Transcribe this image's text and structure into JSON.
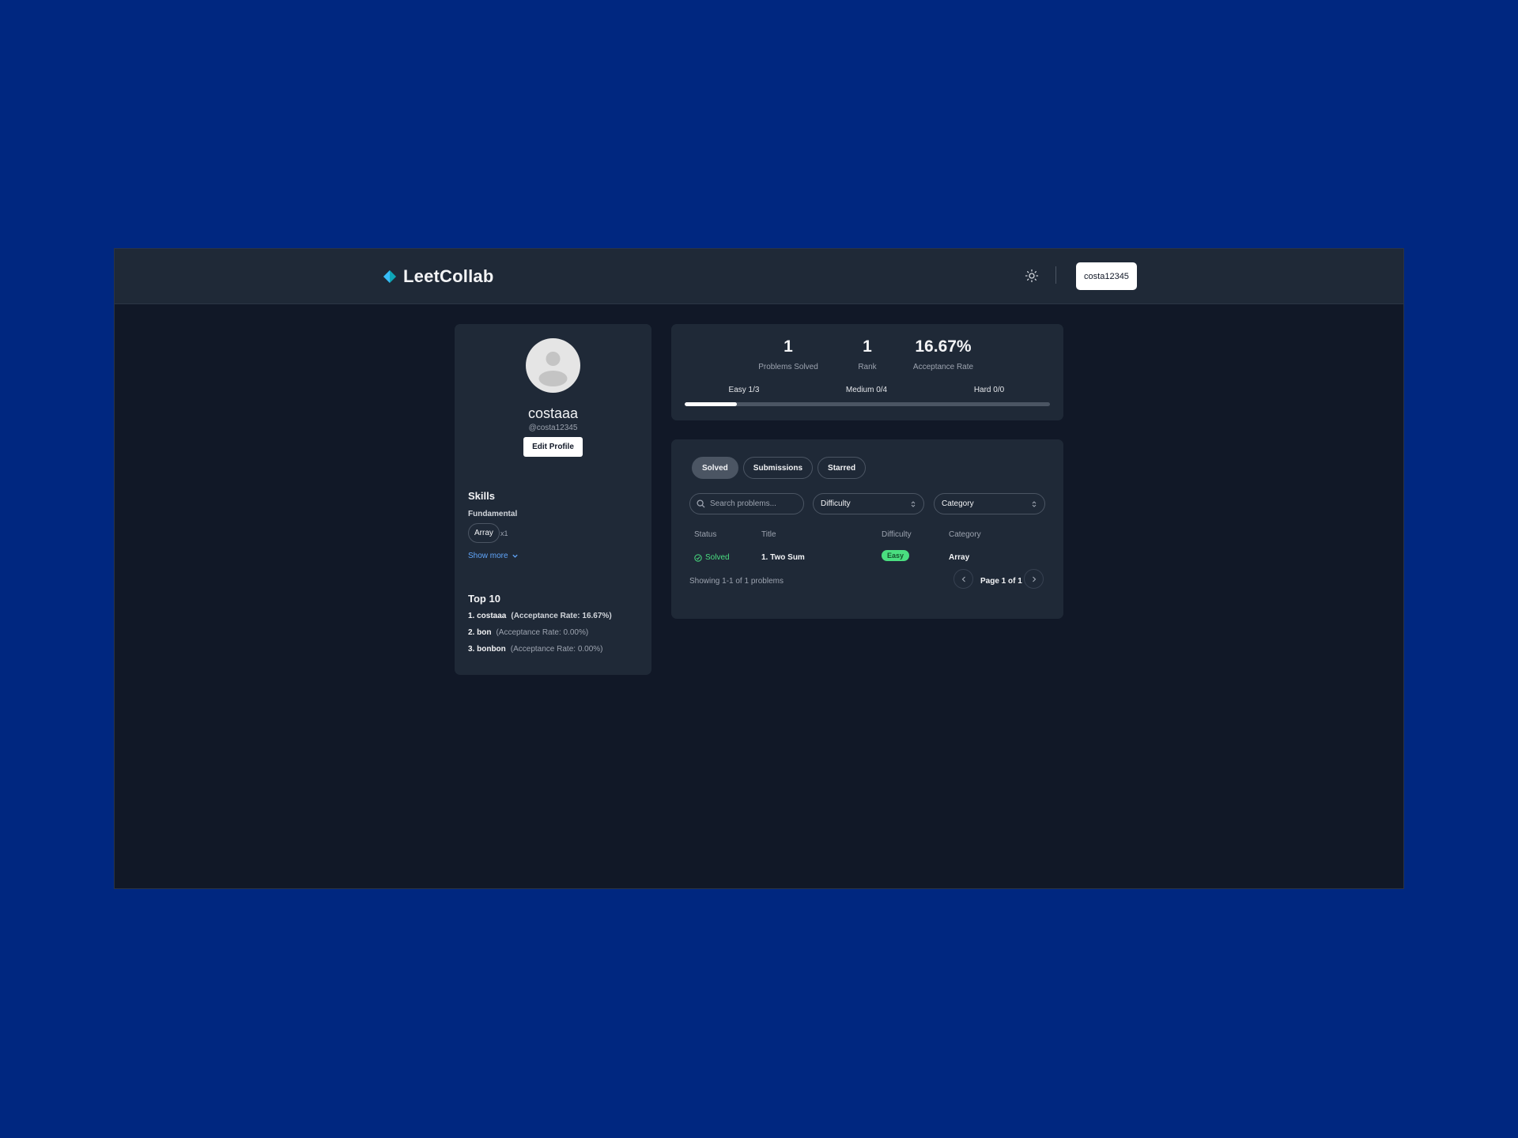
{
  "navbar": {
    "brand": "LeetCollab",
    "user_button": "costa12345",
    "theme_icon": "sun-icon"
  },
  "profile": {
    "display_name": "costaaa",
    "handle": "@costa12345",
    "edit_button": "Edit Profile",
    "skills": {
      "title": "Skills",
      "group": "Fundamental",
      "chips": [
        {
          "label": "Array",
          "count": "x1"
        }
      ],
      "show_more": "Show more"
    },
    "leaderboard": {
      "title": "Top 10",
      "rows": [
        {
          "rank_name": "1. costaaa",
          "rate": "(Acceptance Rate: 16.67%)"
        },
        {
          "rank_name": "2. bon",
          "rate": "(Acceptance Rate: 0.00%)"
        },
        {
          "rank_name": "3. bonbon",
          "rate": "(Acceptance Rate: 0.00%)"
        }
      ]
    }
  },
  "stats": {
    "solved": {
      "value": "1",
      "label": "Problems Solved"
    },
    "rank": {
      "value": "1",
      "label": "Rank"
    },
    "acceptance": {
      "value": "16.67%",
      "label": "Acceptance Rate"
    },
    "difficulty": {
      "easy": "Easy 1/3",
      "medium": "Medium 0/4",
      "hard": "Hard 0/0"
    },
    "progress_fraction": 0.143
  },
  "problems": {
    "tabs": [
      {
        "label": "Solved",
        "active": true
      },
      {
        "label": "Submissions",
        "active": false
      },
      {
        "label": "Starred",
        "active": false
      }
    ],
    "search_placeholder": "Search problems...",
    "difficulty_select": "Difficulty",
    "category_select": "Category",
    "columns": {
      "status": "Status",
      "title": "Title",
      "difficulty": "Difficulty",
      "category": "Category"
    },
    "rows": [
      {
        "status": "Solved",
        "title": "1. Two Sum",
        "difficulty": "Easy",
        "category": "Array"
      }
    ],
    "showing": "Showing 1-1 of 1 problems",
    "page": "Page 1 of 1"
  },
  "colors": {
    "background": "#002780",
    "app": "#111827",
    "card": "#1f2937",
    "accent_green": "#4ade80",
    "link_blue": "#60a5fa"
  }
}
